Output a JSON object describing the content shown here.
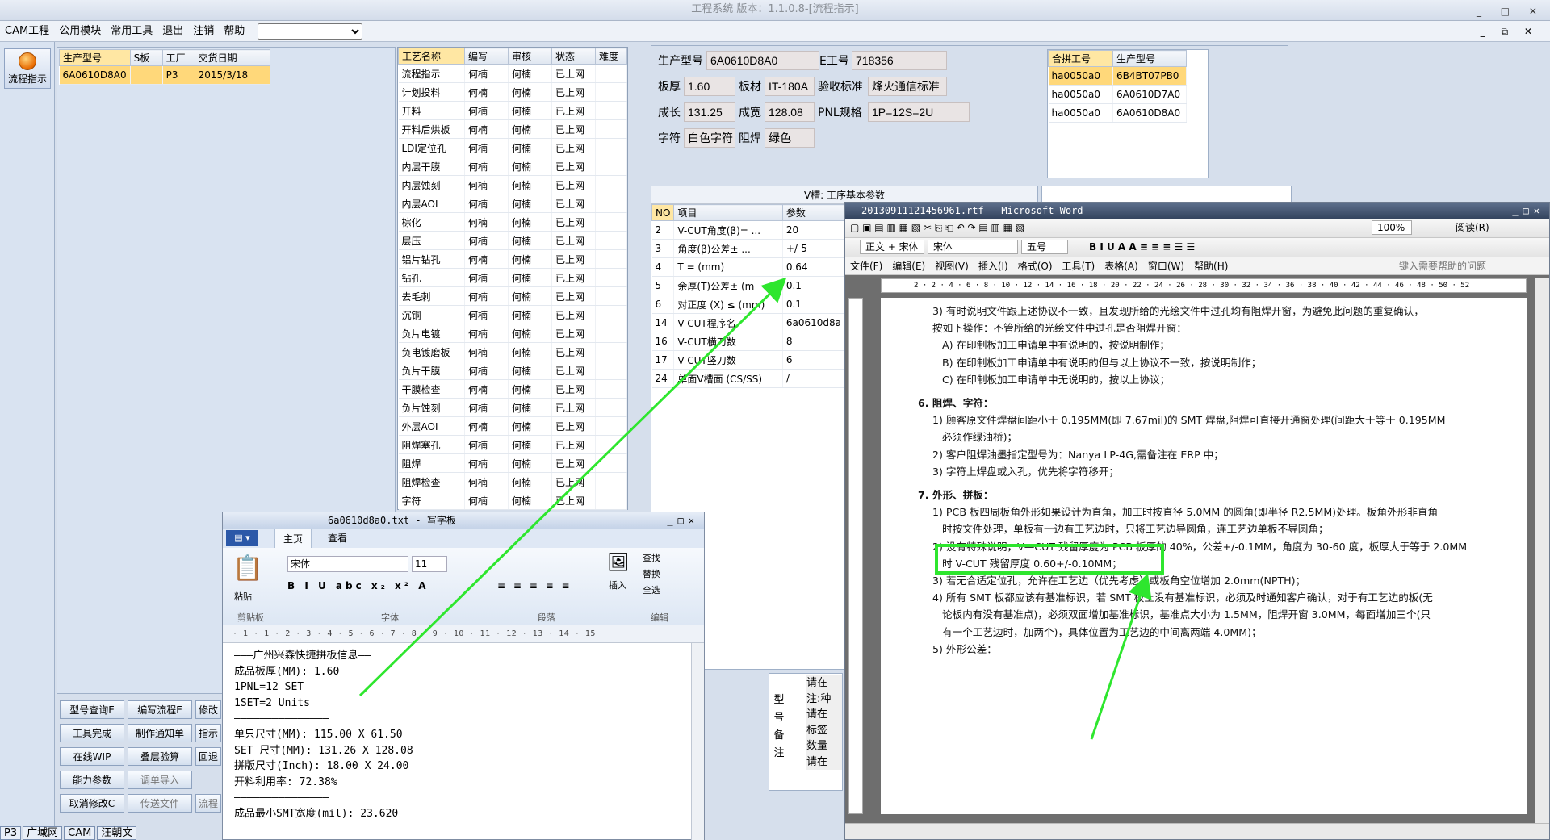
{
  "app": {
    "title": "工程系统 版本：1.1.0.8-[流程指示]",
    "win_controls": "_ □ ✕",
    "menu": [
      "CAM工程",
      "公用模块",
      "常用工具",
      "退出",
      "注销",
      "帮助"
    ],
    "menu_select_value": "",
    "side_tool": {
      "label": "流程指示",
      "icon": "process-flow-icon"
    },
    "mdi_controls": "_ ⧉ ✕"
  },
  "part_list": {
    "headers": [
      "生产型号",
      "S板",
      "工厂",
      "交货日期"
    ],
    "rows": [
      [
        "6A0610D8A0",
        "",
        "P3",
        "2015/3/18"
      ]
    ]
  },
  "process_list": {
    "headers": [
      "工艺名称",
      "编写",
      "审核",
      "状态",
      "难度"
    ],
    "rows": [
      [
        "流程指示",
        "何楠",
        "何楠",
        "已上网",
        ""
      ],
      [
        "计划投料",
        "何楠",
        "何楠",
        "已上网",
        ""
      ],
      [
        "开料",
        "何楠",
        "何楠",
        "已上网",
        ""
      ],
      [
        "开料后烘板",
        "何楠",
        "何楠",
        "已上网",
        ""
      ],
      [
        "LDI定位孔",
        "何楠",
        "何楠",
        "已上网",
        ""
      ],
      [
        "内层干膜",
        "何楠",
        "何楠",
        "已上网",
        ""
      ],
      [
        "内层蚀刻",
        "何楠",
        "何楠",
        "已上网",
        ""
      ],
      [
        "内层AOI",
        "何楠",
        "何楠",
        "已上网",
        ""
      ],
      [
        "棕化",
        "何楠",
        "何楠",
        "已上网",
        ""
      ],
      [
        "层压",
        "何楠",
        "何楠",
        "已上网",
        ""
      ],
      [
        "铝片钻孔",
        "何楠",
        "何楠",
        "已上网",
        ""
      ],
      [
        "钻孔",
        "何楠",
        "何楠",
        "已上网",
        ""
      ],
      [
        "去毛刺",
        "何楠",
        "何楠",
        "已上网",
        ""
      ],
      [
        "沉铜",
        "何楠",
        "何楠",
        "已上网",
        ""
      ],
      [
        "负片电镀",
        "何楠",
        "何楠",
        "已上网",
        ""
      ],
      [
        "负电镀磨板",
        "何楠",
        "何楠",
        "已上网",
        ""
      ],
      [
        "负片干膜",
        "何楠",
        "何楠",
        "已上网",
        ""
      ],
      [
        "干膜检查",
        "何楠",
        "何楠",
        "已上网",
        ""
      ],
      [
        "负片蚀刻",
        "何楠",
        "何楠",
        "已上网",
        ""
      ],
      [
        "外层AOI",
        "何楠",
        "何楠",
        "已上网",
        ""
      ],
      [
        "阻焊塞孔",
        "何楠",
        "何楠",
        "已上网",
        ""
      ],
      [
        "阻焊",
        "何楠",
        "何楠",
        "已上网",
        ""
      ],
      [
        "阻焊检查",
        "何楠",
        "何楠",
        "已上网",
        ""
      ],
      [
        "字符",
        "何楠",
        "何楠",
        "已上网",
        ""
      ]
    ]
  },
  "buttons": [
    [
      "型号查询E",
      "编写流程E",
      "修改"
    ],
    [
      "工具完成",
      "制作通知单",
      "指示"
    ],
    [
      "在线WIP",
      "叠层验算",
      "回退"
    ],
    [
      "能力参数",
      "调单导入",
      ""
    ],
    [
      "取消修改C",
      "传送文件",
      "流程"
    ]
  ],
  "info": {
    "model_label": "生产型号",
    "model_value": "6A0610D8A0",
    "eno_label": "E工号",
    "eno_value": "718356",
    "thick_label": "板厚",
    "thick_value": "1.60",
    "material_label": "板材",
    "material_value": "IT-180A",
    "std_label": "验收标准",
    "std_value": "烽火通信标准",
    "len_label": "成长",
    "len_value": "131.25",
    "wid_label": "成宽",
    "wid_value": "128.08",
    "pnl_label": "PNL规格",
    "pnl_value": "1P=12S=2U",
    "char_label": "字符",
    "char_value": "白色字符",
    "mask_label": "阻焊",
    "mask_value": "绿色"
  },
  "combine_table": {
    "headers": [
      "合拼工号",
      "生产型号"
    ],
    "rows": [
      [
        "ha0050a0",
        "6B4BT07PB0"
      ],
      [
        "ha0050a0",
        "6A0610D7A0"
      ],
      [
        "ha0050a0",
        "6A0610D8A0"
      ]
    ]
  },
  "vcut": {
    "title": "V槽: 工序基本参数",
    "headers": [
      "NO",
      "项目",
      "参数"
    ],
    "rows": [
      [
        "2",
        "V-CUT角度(β)= ...",
        "20"
      ],
      [
        "3",
        "角度(β)公差± ...",
        "+/-5"
      ],
      [
        "4",
        "T = (mm)",
        "0.64"
      ],
      [
        "5",
        "余厚(T)公差± (m",
        "0.1"
      ],
      [
        "6",
        "对正度 (X) ≤ (mm)",
        "0.1"
      ],
      [
        "14",
        "V-CUT程序名",
        "6a0610d8a"
      ],
      [
        "16",
        "V-CUT横刀数",
        "8"
      ],
      [
        "17",
        "V-CUT竖刀数",
        "6"
      ],
      [
        "24",
        "单面V槽面 (CS/SS)",
        "/"
      ]
    ]
  },
  "notes": {
    "vertical_label": "型号备注",
    "lines": [
      "请在",
      "注:种",
      "请在",
      "标签",
      "数量",
      "请在"
    ]
  },
  "bottom_tabs": [
    "P3",
    "广域网",
    "CAM",
    "汪朝文"
  ],
  "word": {
    "title": "20130911121456961.rtf - Microsoft Word",
    "menu": [
      "文件(F)",
      "编辑(E)",
      "视图(V)",
      "插入(I)",
      "格式(O)",
      "工具(T)",
      "表格(A)",
      "窗口(W)",
      "帮助(H)"
    ],
    "help_placeholder": "键入需要帮助的问题",
    "style_value": "正文 + 宋体",
    "font_value": "宋体",
    "size_value": "五号",
    "zoom_value": "100%",
    "reading_label": "阅读(R)",
    "ruler": "2 · 2 · 4 · 6 · 8 · 10 · 12 · 14 · 16 · 18 · 20 · 22 · 24 · 26 · 28 · 30 · 32 · 34 · 36 · 38 · 40 · 42 · 44 · 46 · 48 · 50 · 52",
    "doc": [
      "3) 有时说明文件跟上述协议不一致，且发现所给的光绘文件中过孔均有阻焊开窗，为避免此问题的重复确认，",
      "按如下操作：不管所给的光绘文件中过孔是否阻焊开窗：",
      "A) 在印制板加工申请单中有说明的，按说明制作；",
      "B) 在印制板加工申请单中有说明的但与以上协议不一致，按说明制作；",
      "C) 在印制板加工申请单中无说明的，按以上协议；",
      "6. 阻焊、字符：",
      "1) 顾客原文件焊盘间距小于 0.195MM(即 7.67mil)的 SMT 焊盘,阻焊可直接开通窗处理(间距大于等于 0.195MM",
      "必须作绿油桥)；",
      "2) 客户阻焊油墨指定型号为：Nanya LP-4G,需备注在 ERP 中；",
      "3) 字符上焊盘或入孔，优先将字符移开；",
      "7. 外形、拼板：",
      "1) PCB 板四周板角外形如果设计为直角，加工时按直径 5.0MM 的圆角(即半径 R2.5MM)处理。板角外形非直角",
      "时按文件处理，单板有一边有工艺边时，只将工艺边导圆角，连工艺边单板不导圆角；",
      "2) 没有特殊说明，V—CUT 残留厚度为 PCB 板厚的 40%，公差+/-0.1MM，角度为 30-60 度，板厚大于等于 2.0MM",
      "时 V-CUT 残留厚度 0.60+/-0.10MM；",
      "3) 若无合适定位孔，允许在工艺边（优先考虑）或板角空位增加 2.0mm(NPTH)；",
      "4) 所有 SMT 板都应该有基准标识，若 SMT 板上没有基准标识，必须及时通知客户确认，对于有工艺边的板(无",
      "论板内有没有基准点)，必须双面增加基准标识，基准点大小为 1.5MM，阻焊开窗 3.0MM，每面增加三个(只",
      "有一个工艺边时，加两个)，具体位置为工艺边的中间离两端 4.0MM)；",
      "5) 外形公差："
    ]
  },
  "wordpad": {
    "title": "6a0610d8a0.txt - 写字板",
    "tabs": [
      "主页",
      "查看"
    ],
    "font_value": "宋体",
    "size_value": "11",
    "paste_label": "粘贴",
    "insert_label": "插入",
    "find_label": "查找",
    "replace_label": "替换",
    "selectall_label": "全选",
    "group_clip": "剪贴板",
    "group_font": "字体",
    "group_para": "段落",
    "group_edit": "编辑",
    "ruler": "· 1 · 1 · 2 · 3 · 4 · 5 · 6 · 7 · 8 · 9 · 10 · 11 · 12 · 13 · 14 · 15",
    "lines": [
      "———广州兴森快捷拼板信息——",
      "成品板厚(MM): 1.60",
      "1PNL=12 SET",
      "1SET=2 Units",
      "———————————————",
      "单只尺寸(MM): 115.00 X 61.50",
      "SET 尺寸(MM): 131.26 X 128.08",
      "拼版尺寸(Inch): 18.00 X 24.00",
      "开料利用率: 72.38%",
      "———————————————",
      "成品最小SMT宽度(mil): 23.620"
    ]
  },
  "colors": {
    "highlight_row": "#ffd87a",
    "annotation_green": "#2ee62e",
    "red_text": "#c8251f",
    "blue_text": "#1b2fbb"
  }
}
